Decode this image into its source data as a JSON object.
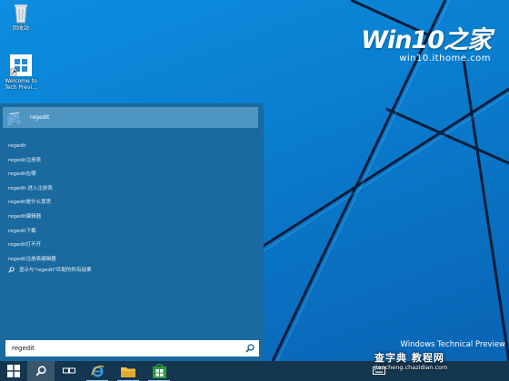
{
  "desktop": {
    "icons": [
      {
        "label": "回收站",
        "icon": "recycle-bin-icon"
      },
      {
        "label": "Welcome to Tech Previ...",
        "icon": "windows-logo-icon"
      }
    ],
    "watermark_brand": "Win10之家",
    "watermark_url": "win10.ithome.com",
    "preview_text": "Windows Technical Preview"
  },
  "search": {
    "top_result": {
      "label": "regedit",
      "icon": "regedit-icon"
    },
    "suggestions": [
      "regedit",
      "regedit注册表",
      "regedit在哪",
      "regedit 进入注册表",
      "regedit是什么意思",
      "regedit编辑器",
      "regedit下载",
      "regedit打不开",
      "regedit注册表编辑器"
    ],
    "web_search_label": "显示与\"regedit\"匹配的所有结果",
    "query": "regedit",
    "icon": "search-icon"
  },
  "taskbar": {
    "items": [
      {
        "name": "start-button",
        "icon": "windows-logo-icon"
      },
      {
        "name": "search-button",
        "icon": "search-icon"
      },
      {
        "name": "task-view-button",
        "icon": "task-view-icon"
      },
      {
        "name": "internet-explorer-button",
        "icon": "internet-explorer-icon"
      },
      {
        "name": "file-explorer-button",
        "icon": "folder-icon"
      },
      {
        "name": "store-button",
        "icon": "store-icon"
      }
    ],
    "tray_icon": "keyboard-icon",
    "footer_watermark_title": "查字典 教程网",
    "footer_watermark_url": "jiaocheng.chazidian.com"
  },
  "colors": {
    "desktop_blue": "#0a7ccd",
    "panel_blue": "#1a6a9f",
    "highlight_blue": "#4f95c2",
    "taskbar": "#14364f"
  }
}
